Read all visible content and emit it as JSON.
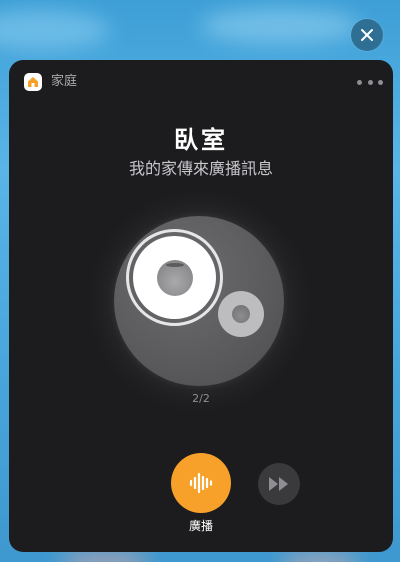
{
  "header": {
    "app_label": "家庭",
    "home_icon": "house-icon",
    "more_icon": "ellipsis-icon"
  },
  "main": {
    "room_title": "臥室",
    "subtitle": "我的家傳來廣播訊息",
    "page_indicator": "2/2"
  },
  "controls": {
    "intercom_label": "廣播",
    "intercom_icon": "waveform-icon",
    "skip_icon": "fast-forward-icon",
    "close_icon": "close-icon"
  },
  "colors": {
    "accent": "#f7a12a",
    "card_background": "#1c1c1e",
    "home_icon_color": "#f7a12a",
    "close_button": "#2f6f94"
  }
}
